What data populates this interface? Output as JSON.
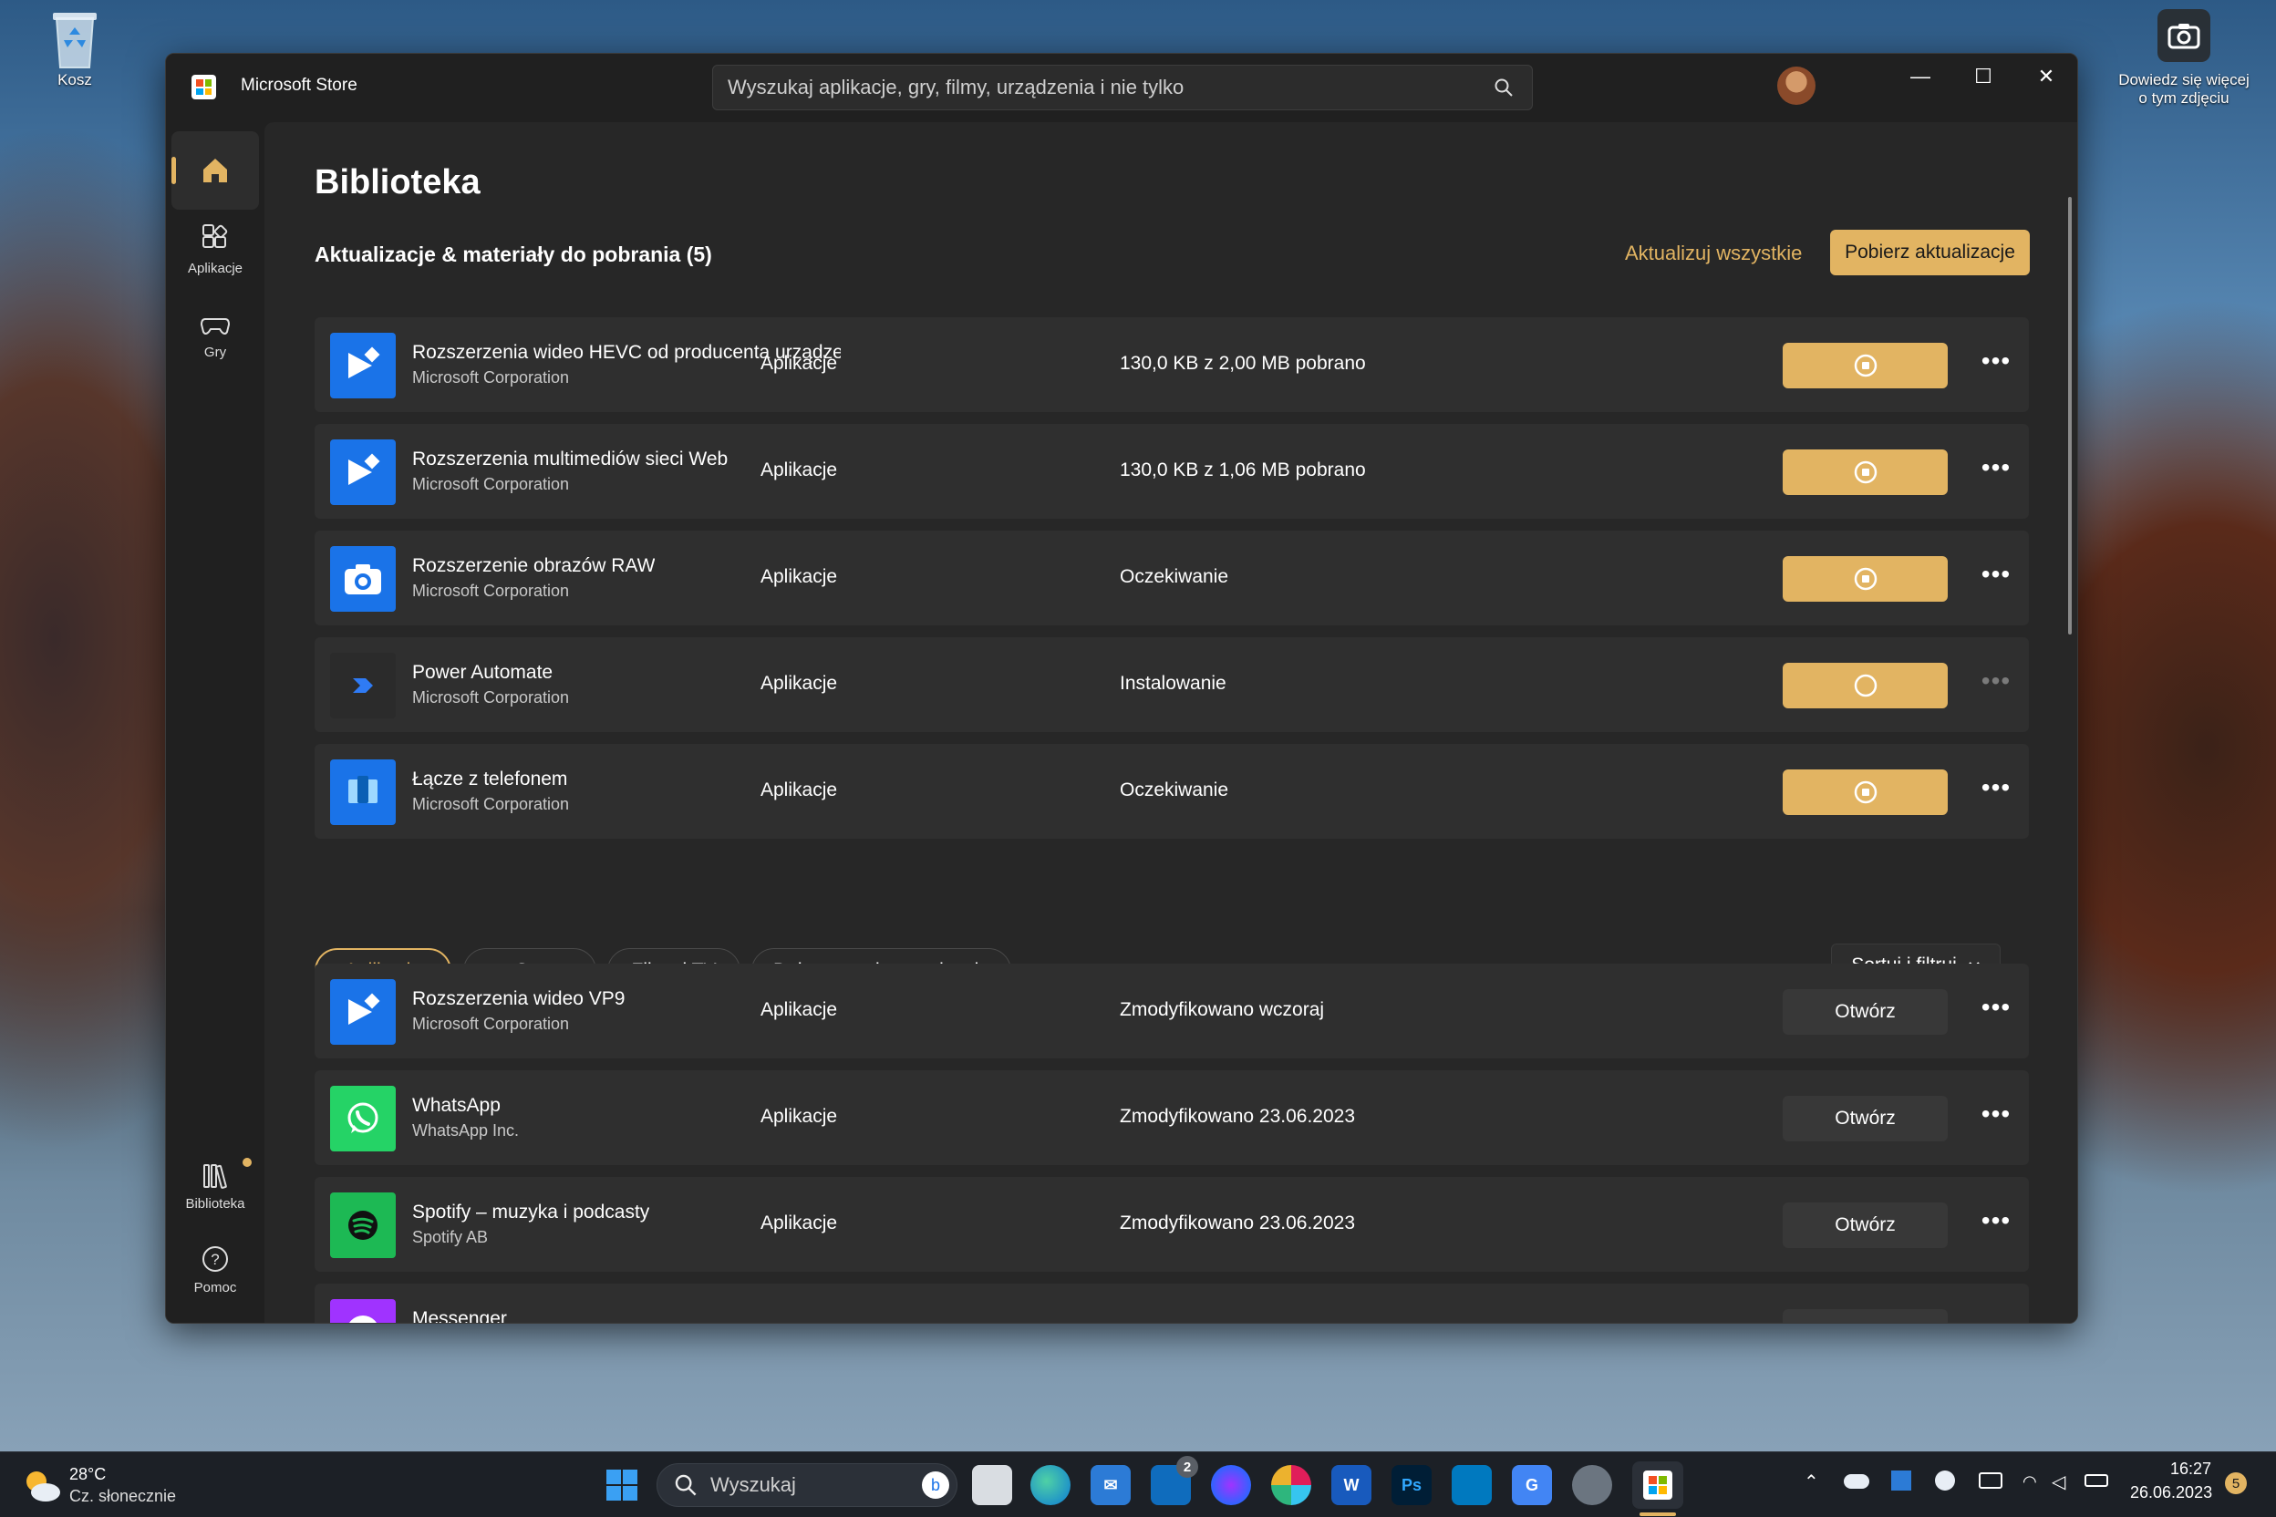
{
  "desktop": {
    "recycle_label": "Kosz",
    "spotlight_label_1": "Dowiedz się więcej",
    "spotlight_label_2": "o tym zdjęciu"
  },
  "window": {
    "title": "Microsoft Store",
    "search_placeholder": "Wyszukaj aplikacje, gry, filmy, urządzenia i nie tylko",
    "controls": {
      "minimize": "—",
      "maximize": "☐",
      "close": "✕"
    }
  },
  "sidebar": {
    "items": [
      {
        "label": "",
        "icon": "home-icon"
      },
      {
        "label": "Aplikacje",
        "icon": "apps-icon"
      },
      {
        "label": "Gry",
        "icon": "gamepad-icon"
      }
    ],
    "bottom": [
      {
        "label": "Biblioteka",
        "icon": "library-icon"
      },
      {
        "label": "Pomoc",
        "icon": "help-icon"
      }
    ]
  },
  "library": {
    "title": "Biblioteka",
    "updates_heading": "Aktualizacje & materiały do pobrania (5)",
    "update_all": "Aktualizuj wszystkie",
    "get_updates": "Pobierz aktualizacje",
    "updates": [
      {
        "name": "Rozszerzenia wideo HEVC od producenta urządze...",
        "publisher": "Microsoft Corporation",
        "category": "Aplikacje",
        "status": "130,0 KB z 2,00 MB pobrano",
        "icon": "video-extension-icon",
        "color": "#1a73e8",
        "more": "•••"
      },
      {
        "name": "Rozszerzenia multimediów sieci Web",
        "publisher": "Microsoft Corporation",
        "category": "Aplikacje",
        "status": "130,0 KB z 1,06 MB pobrano",
        "icon": "video-extension-icon",
        "color": "#1a73e8",
        "more": "•••"
      },
      {
        "name": "Rozszerzenie obrazów RAW",
        "publisher": "Microsoft Corporation",
        "category": "Aplikacje",
        "status": "Oczekiwanie",
        "icon": "camera-icon",
        "color": "#1a73e8",
        "more": "•••"
      },
      {
        "name": "Power Automate",
        "publisher": "Microsoft Corporation",
        "category": "Aplikacje",
        "status": "Instalowanie",
        "icon": "power-automate-icon",
        "color": "#2b2b2b",
        "more": "•••"
      },
      {
        "name": "Łącze z telefonem",
        "publisher": "Microsoft Corporation",
        "category": "Aplikacje",
        "status": "Oczekiwanie",
        "icon": "phone-link-icon",
        "color": "#1a73e8",
        "more": "•••"
      }
    ],
    "filters": [
      "Aplikacje",
      "Gry",
      "Filmy i TV",
      "Dołączone do urządzenia"
    ],
    "sort": "Sortuj i filtruj",
    "apps": [
      {
        "name": "Rozszerzenia wideo VP9",
        "publisher": "Microsoft Corporation",
        "category": "Aplikacje",
        "status": "Zmodyfikowano wczoraj",
        "action": "Otwórz",
        "icon": "video-extension-icon",
        "color": "#1a73e8",
        "more": "•••"
      },
      {
        "name": "WhatsApp",
        "publisher": "WhatsApp Inc.",
        "category": "Aplikacje",
        "status": "Zmodyfikowano 23.06.2023",
        "action": "Otwórz",
        "icon": "whatsapp-icon",
        "color": "#25d366",
        "more": "•••"
      },
      {
        "name": "Spotify – muzyka i podcasty",
        "publisher": "Spotify AB",
        "category": "Aplikacje",
        "status": "Zmodyfikowano 23.06.2023",
        "action": "Otwórz",
        "icon": "spotify-icon",
        "color": "#1db954",
        "more": "•••"
      },
      {
        "name": "Messenger",
        "publisher": "",
        "category": "",
        "status": "",
        "action": "",
        "icon": "messenger-icon",
        "color": "#a033ff",
        "more": ""
      }
    ]
  },
  "taskbar": {
    "weather_temp": "28°C",
    "weather_desc": "Cz. słonecznie",
    "search_placeholder": "Wyszukaj",
    "mail_badge": "2",
    "time": "16:27",
    "date": "26.06.2023",
    "notif_count": "5"
  },
  "colors": {
    "accent": "#e2b462",
    "window_bg": "#202020",
    "content_bg": "#272727",
    "row_bg": "#2f2f2f"
  }
}
